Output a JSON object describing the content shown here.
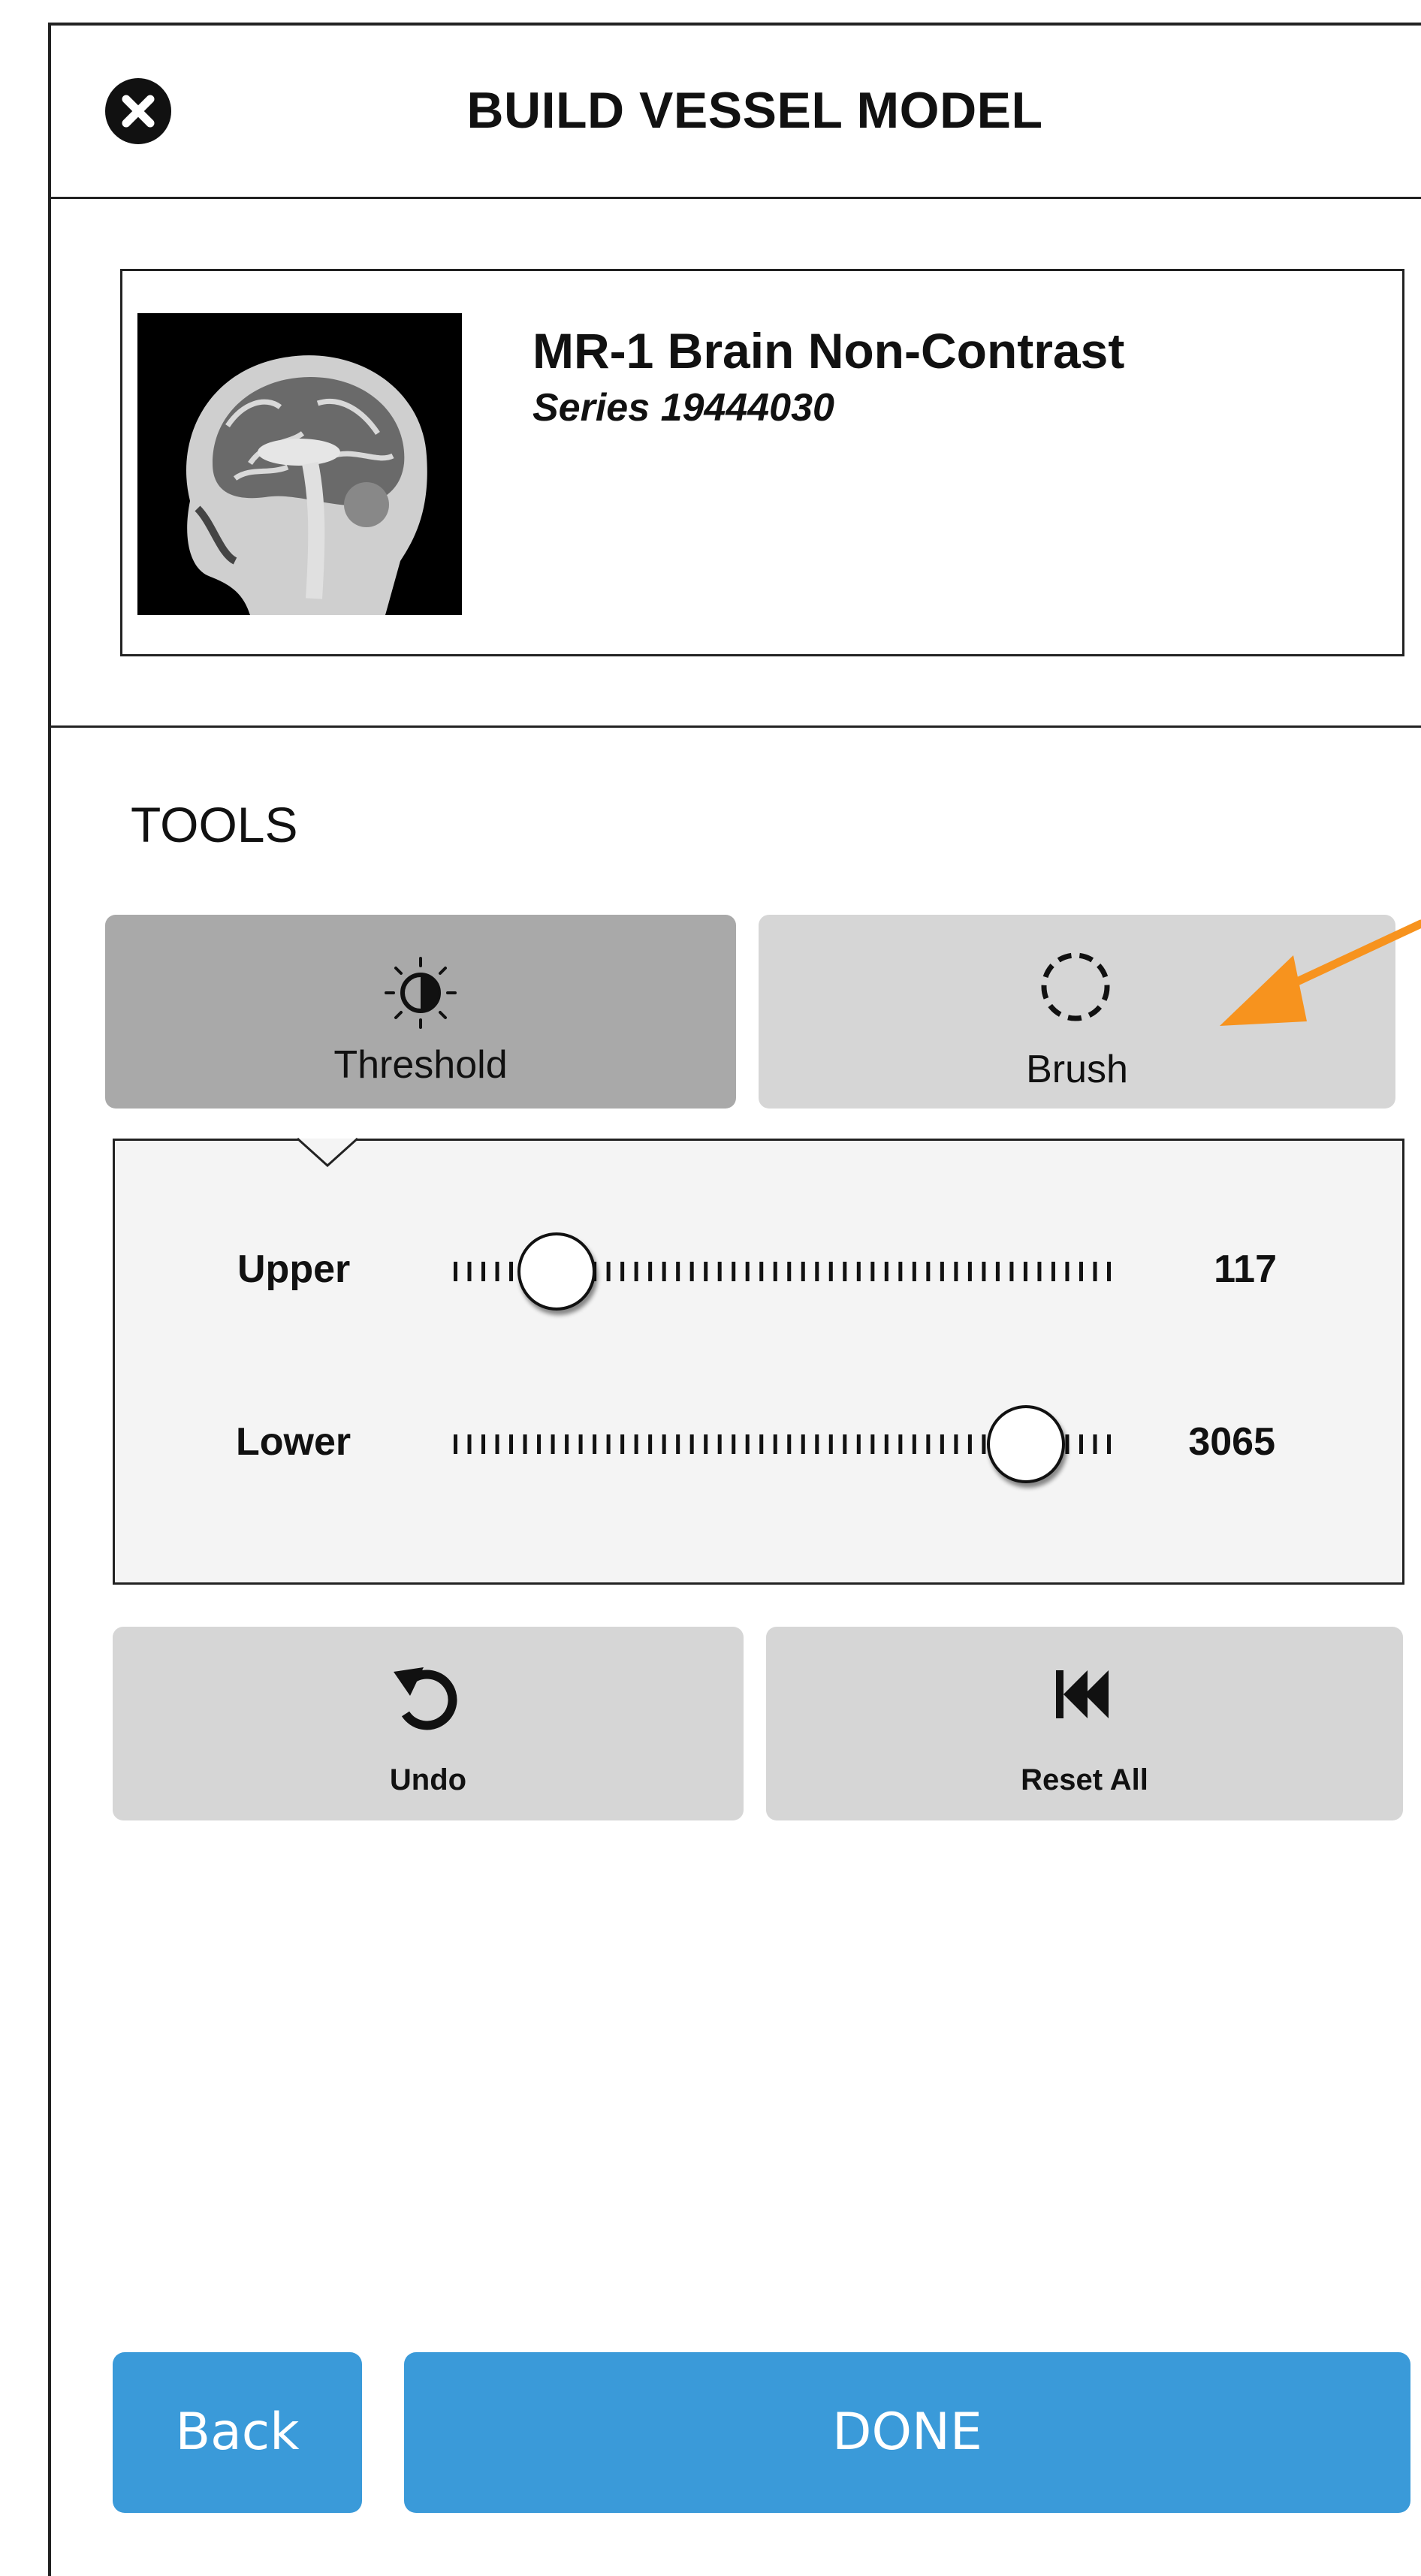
{
  "header": {
    "title": "BUILD VESSEL MODEL",
    "close_icon": "close-icon"
  },
  "study": {
    "title": "MR-1 Brain Non-Contrast",
    "series": "Series 19444030",
    "thumbnail": "brain-mri-thumbnail"
  },
  "tools": {
    "section_label": "TOOLS",
    "items": [
      {
        "label": "Threshold",
        "icon": "contrast-icon",
        "selected": true
      },
      {
        "label": "Brush",
        "icon": "dashed-circle-icon",
        "selected": false
      }
    ]
  },
  "threshold": {
    "sliders": [
      {
        "label": "Upper",
        "value": "117",
        "position": 0.16
      },
      {
        "label": "Lower",
        "value": "3065",
        "position": 0.87
      }
    ]
  },
  "actions": {
    "undo_label": "Undo",
    "reset_label": "Reset All"
  },
  "footer": {
    "back_label": "Back",
    "done_label": "DONE"
  },
  "colors": {
    "primary_button": "#3a9ad9",
    "selected_tool": "#a9a9a9",
    "tool_bg": "#d6d6d6",
    "annotation_arrow": "#f7931e"
  }
}
